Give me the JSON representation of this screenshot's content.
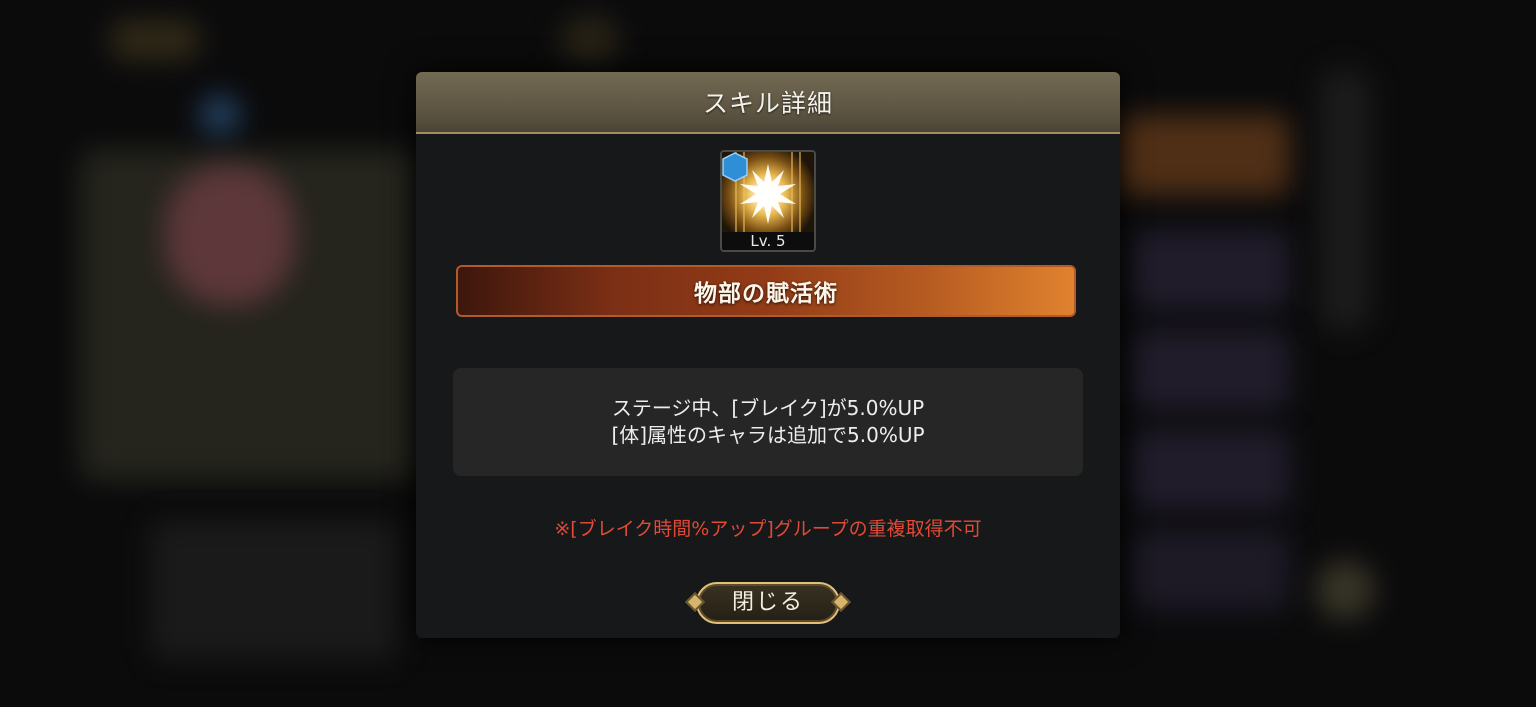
{
  "dialog": {
    "title": "スキル詳細",
    "skill": {
      "icon": "burst-light-icon",
      "level": "Lv. 5",
      "name": "物部の賦活術"
    },
    "description": [
      "ステージ中、[ブレイク]が5.0%UP",
      "[体]属性のキャラは追加で5.0%UP"
    ],
    "warning": "※[ブレイク時間%アップ]グループの重複取得不可",
    "close_label": "閉じる"
  },
  "colors": {
    "header": "#5b5341",
    "name_bar_start": "#3d160c",
    "name_bar_end": "#e0822e",
    "warning": "#e04a36",
    "badge": "#2f8fd6"
  }
}
